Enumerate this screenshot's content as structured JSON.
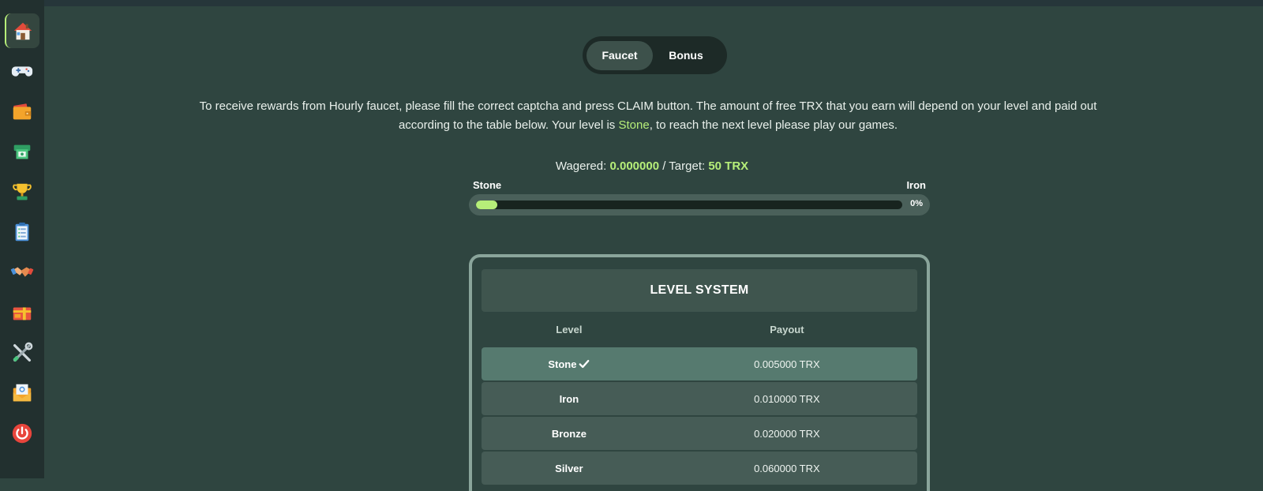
{
  "sidebar": {
    "items": [
      {
        "name": "home",
        "icon": "house-icon",
        "active": true
      },
      {
        "name": "games",
        "icon": "gamepad-icon",
        "active": false
      },
      {
        "name": "wallet",
        "icon": "wallet-icon",
        "active": false
      },
      {
        "name": "withdraw",
        "icon": "atm-icon",
        "active": false
      },
      {
        "name": "rewards",
        "icon": "trophy-icon",
        "active": false
      },
      {
        "name": "tasks",
        "icon": "clipboard-icon",
        "active": false
      },
      {
        "name": "affiliate",
        "icon": "handshake-icon",
        "active": false
      },
      {
        "name": "gift",
        "icon": "gift-icon",
        "active": false
      },
      {
        "name": "tools",
        "icon": "tools-icon",
        "active": false
      },
      {
        "name": "contact",
        "icon": "mail-icon",
        "active": false
      },
      {
        "name": "logout",
        "icon": "power-icon",
        "active": false
      }
    ]
  },
  "tabs": [
    {
      "label": "Faucet",
      "active": true
    },
    {
      "label": "Bonus",
      "active": false
    }
  ],
  "intro": {
    "line_before": "To receive rewards from Hourly faucet, please fill the correct captcha and press CLAIM button. The amount of free TRX that you earn will depend on your level and paid out according to the table below. Your level is ",
    "level": "Stone",
    "line_after": ", to reach the next level please play our games."
  },
  "wager": {
    "wagered_label": "Wagered:",
    "wagered_value": "0.000000",
    "separator": "/",
    "target_label": "Target:",
    "target_value": "50 TRX"
  },
  "progress": {
    "current_level": "Stone",
    "next_level": "Iron",
    "percent_label": "0%",
    "percent": 0
  },
  "level_system": {
    "title": "LEVEL SYSTEM",
    "col_level": "Level",
    "col_payout": "Payout",
    "rows": [
      {
        "level": "Stone",
        "payout": "0.005000 TRX",
        "current": true
      },
      {
        "level": "Iron",
        "payout": "0.010000 TRX",
        "current": false
      },
      {
        "level": "Bronze",
        "payout": "0.020000 TRX",
        "current": false
      },
      {
        "level": "Silver",
        "payout": "0.060000 TRX",
        "current": false
      }
    ]
  },
  "colors": {
    "accent": "#b6ee79",
    "background": "#2f4540",
    "sidebar": "#22302f"
  }
}
